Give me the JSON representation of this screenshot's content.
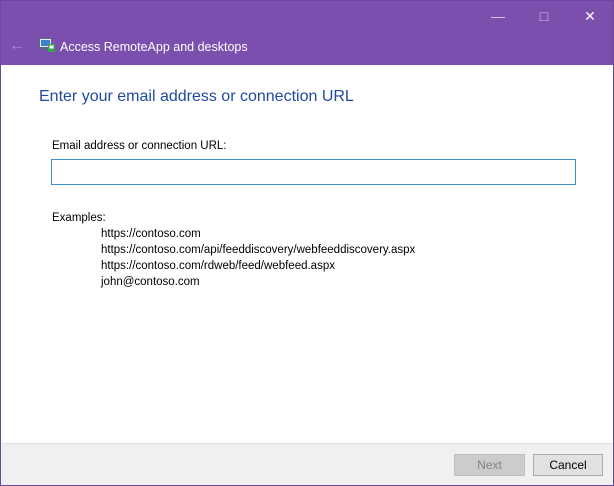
{
  "window": {
    "title": "Access RemoteApp and desktops",
    "accent_color": "#7b4fae",
    "icons": {
      "back": "back-arrow-icon",
      "app": "remoteapp-icon",
      "minimize": "minimize-icon",
      "maximize": "maximize-icon",
      "close": "close-icon"
    }
  },
  "main": {
    "heading": "Enter your email address or connection URL",
    "field_label": "Email address or connection URL:",
    "field_value": "",
    "examples_label": "Examples:",
    "examples": [
      "https://contoso.com",
      "https://contoso.com/api/feeddiscovery/webfeeddiscovery.aspx",
      "https://contoso.com/rdweb/feed/webfeed.aspx",
      "john@contoso.com"
    ]
  },
  "footer": {
    "next_label": "Next",
    "cancel_label": "Cancel"
  }
}
